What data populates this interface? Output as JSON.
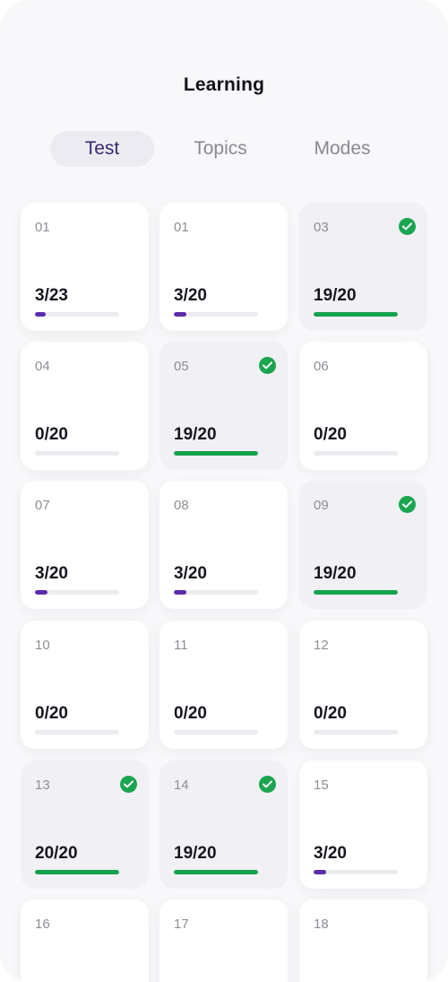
{
  "header": {
    "title": "Learning"
  },
  "tabs": [
    {
      "label": "Test",
      "active": true
    },
    {
      "label": "Topics",
      "active": false
    },
    {
      "label": "Modes",
      "active": false
    }
  ],
  "colors": {
    "accent": "#5b2bad",
    "success": "#15a24d"
  },
  "cards": [
    {
      "number": "01",
      "score": "3/23",
      "progress": 0.13,
      "completed": false
    },
    {
      "number": "01",
      "score": "3/20",
      "progress": 0.15,
      "completed": false
    },
    {
      "number": "03",
      "score": "19/20",
      "progress": 1.0,
      "completed": true,
      "icon": "check-circle-icon"
    },
    {
      "number": "04",
      "score": "0/20",
      "progress": 0.0,
      "completed": false
    },
    {
      "number": "05",
      "score": "19/20",
      "progress": 1.0,
      "completed": true,
      "icon": "check-circle-icon"
    },
    {
      "number": "06",
      "score": "0/20",
      "progress": 0.0,
      "completed": false
    },
    {
      "number": "07",
      "score": "3/20",
      "progress": 0.15,
      "completed": false
    },
    {
      "number": "08",
      "score": "3/20",
      "progress": 0.15,
      "completed": false
    },
    {
      "number": "09",
      "score": "19/20",
      "progress": 1.0,
      "completed": true,
      "icon": "check-circle-icon"
    },
    {
      "number": "10",
      "score": "0/20",
      "progress": 0.0,
      "completed": false
    },
    {
      "number": "11",
      "score": "0/20",
      "progress": 0.0,
      "completed": false
    },
    {
      "number": "12",
      "score": "0/20",
      "progress": 0.0,
      "completed": false
    },
    {
      "number": "13",
      "score": "20/20",
      "progress": 1.0,
      "completed": true,
      "icon": "check-circle-icon"
    },
    {
      "number": "14",
      "score": "19/20",
      "progress": 1.0,
      "completed": true,
      "icon": "check-circle-icon"
    },
    {
      "number": "15",
      "score": "3/20",
      "progress": 0.15,
      "completed": false
    },
    {
      "number": "16",
      "score": "",
      "progress": null,
      "completed": false
    },
    {
      "number": "17",
      "score": "",
      "progress": null,
      "completed": false
    },
    {
      "number": "18",
      "score": "",
      "progress": null,
      "completed": false
    }
  ]
}
